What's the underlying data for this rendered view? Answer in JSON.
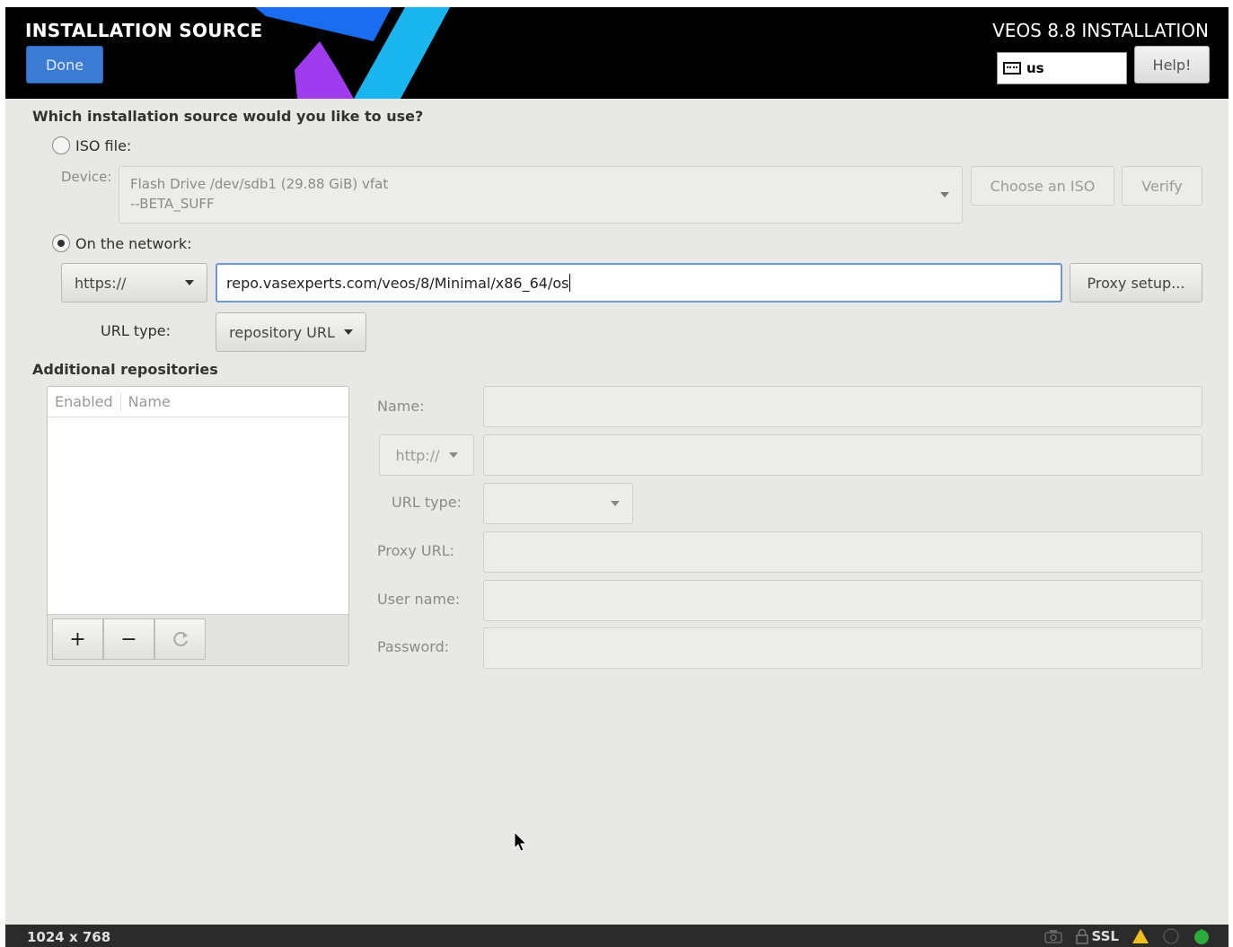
{
  "header": {
    "page_title": "INSTALLATION SOURCE",
    "done_label": "Done",
    "product_title": "VEOS 8.8 INSTALLATION",
    "keyboard_layout": "us",
    "help_label": "Help!",
    "logo_colors": [
      "#1a6cf0",
      "#19b6ef",
      "#a03cf0"
    ]
  },
  "source": {
    "question": "Which installation source would you like to use?",
    "iso_label": "ISO file:",
    "iso_selected": false,
    "device_label": "Device:",
    "device_line1": "Flash Drive /dev/sdb1 (29.88 GiB) vfat",
    "device_line2": "--BETA_SUFF",
    "choose_iso_label": "Choose an ISO",
    "verify_label": "Verify",
    "network_label": "On the network:",
    "network_selected": true,
    "protocol": "https://",
    "url": "repo.vasexperts.com/veos/8/Minimal/x86_64/os",
    "proxy_setup_label": "Proxy setup...",
    "url_type_label": "URL type:",
    "url_type_value": "repository URL"
  },
  "additional": {
    "title": "Additional repositories",
    "columns": [
      "Enabled",
      "Name"
    ],
    "add_label": "+",
    "remove_label": "−",
    "reset_icon": "refresh-icon",
    "name_label": "Name:",
    "protocol": "http://",
    "url_type_label": "URL type:",
    "proxy_url_label": "Proxy URL:",
    "user_name_label": "User name:",
    "password_label": "Password:"
  },
  "statusbar": {
    "resolution": "1024 x 768",
    "ssl_label": "SSL"
  }
}
